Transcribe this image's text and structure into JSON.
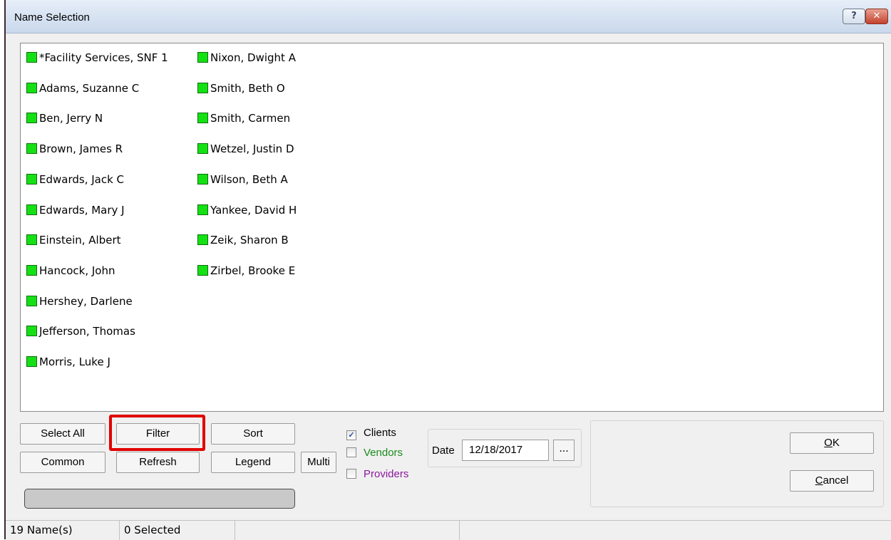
{
  "window": {
    "title": "Name Selection",
    "help_glyph": "?",
    "close_glyph": "✕"
  },
  "names_col1": [
    "*Facility Services, SNF 1",
    "Adams, Suzanne C",
    "Ben, Jerry N",
    "Brown, James R",
    "Edwards, Jack C",
    "Edwards, Mary J",
    "Einstein, Albert",
    "Hancock, John",
    "Hershey, Darlene",
    "Jefferson, Thomas",
    "Morris, Luke J"
  ],
  "names_col2": [
    "Nixon, Dwight A",
    "Smith, Beth O",
    "Smith, Carmen",
    "Wetzel, Justin D",
    "Wilson, Beth A",
    "Yankee, David H",
    "Zeik, Sharon B",
    "Zirbel, Brooke E"
  ],
  "colors": {
    "status_square": "#14e014",
    "vendors_label": "#1a8c1a",
    "providers_label": "#8b1a9e",
    "highlight": "#e00000"
  },
  "buttons": {
    "select_all": "Select All",
    "filter": "Filter",
    "sort": "Sort",
    "common": "Common",
    "refresh": "Refresh",
    "legend": "Legend",
    "multi": "Multi",
    "ok_underlined": "O",
    "ok_rest": "K",
    "cancel_underlined": "C",
    "cancel_rest": "ancel",
    "date_picker": "..."
  },
  "checkboxes": {
    "clients": {
      "label": "Clients",
      "checked": true
    },
    "vendors": {
      "label": "Vendors",
      "checked": false
    },
    "providers": {
      "label": "Providers",
      "checked": false
    }
  },
  "date": {
    "label": "Date",
    "value": "12/18/2017"
  },
  "progress": {
    "fraction": 0
  },
  "status": {
    "names_count": "19 Name(s)",
    "selected_count": "0 Selected"
  }
}
